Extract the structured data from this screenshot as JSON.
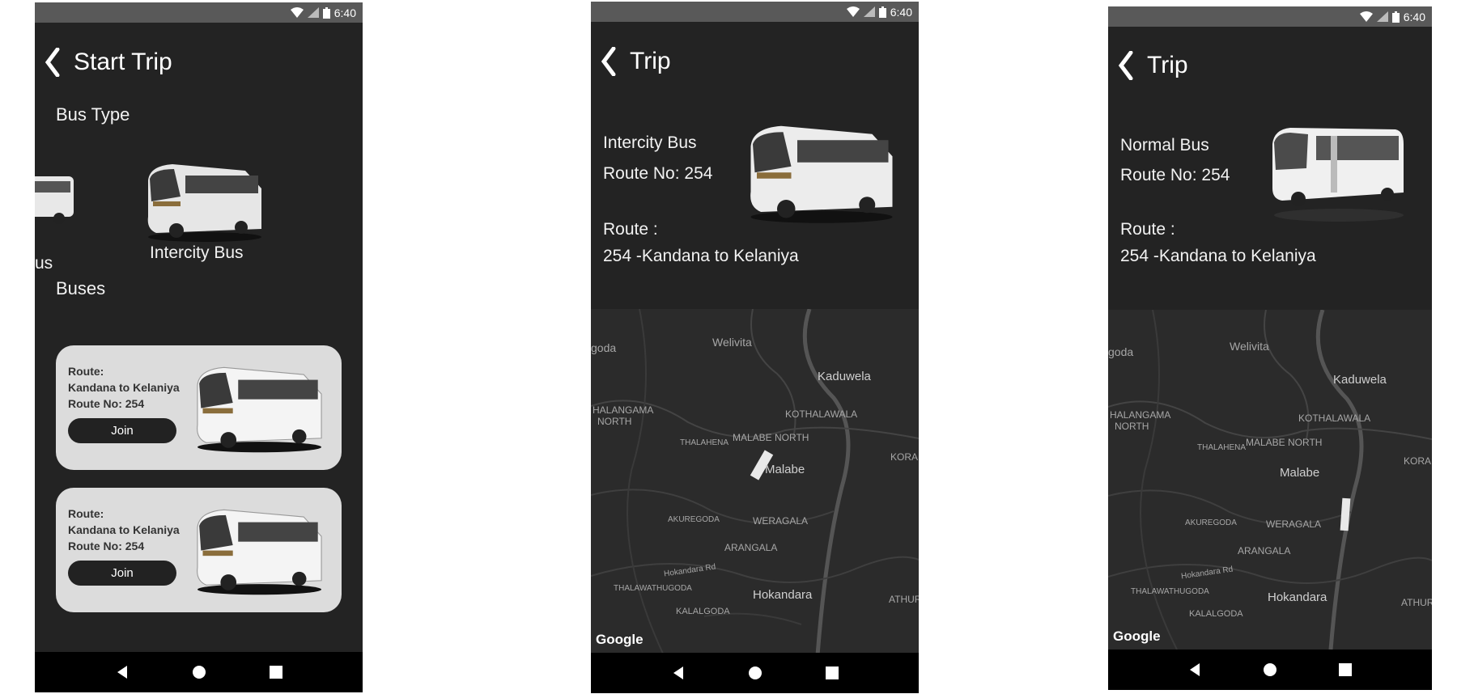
{
  "status_bar": {
    "time": "6:40"
  },
  "screen_start": {
    "title": "Start Trip",
    "bus_type_heading": "Bus Type",
    "bus_types": [
      {
        "label": "us"
      },
      {
        "label": "Intercity Bus"
      }
    ],
    "buses_heading": "Buses",
    "cards": [
      {
        "route_label": "Route:",
        "route": "Kandana to Kelaniya",
        "route_no": "Route No: 254",
        "join_label": "Join"
      },
      {
        "route_label": "Route:",
        "route": "Kandana to Kelaniya",
        "route_no": "Route No: 254",
        "join_label": "Join"
      }
    ]
  },
  "screen_trip_intercity": {
    "title": "Trip",
    "bus_name": "Intercity Bus",
    "route_no": "Route No: 254",
    "route_label": "Route :",
    "route": "254 -Kandana to Kelaniya"
  },
  "screen_trip_normal": {
    "title": "Trip",
    "bus_name": "Normal Bus",
    "route_no": "Route No: 254",
    "route_label": "Route :",
    "route": "254 -Kandana to Kelaniya"
  },
  "map": {
    "labels": {
      "goda": "goda",
      "welivita": "Welivita",
      "kaduwela": "Kaduwela",
      "halangama": "HALANGAMA",
      "north": "NORTH",
      "kothalawala": "KOTHALAWALA",
      "thalahena": "THALAHENA",
      "malabe_north": "MALABE NORTH",
      "malabe": "Malabe",
      "kora": "KORA",
      "akuregoda": "AKUREGODA",
      "weragala": "WERAGALA",
      "arangala": "ARANGALA",
      "hokandara_rd": "Hokandara Rd",
      "thalawathugoda": "THALAWATHUGODA",
      "hokandara": "Hokandara",
      "kalalgoda": "KALALGODA",
      "athur": "ATHUR"
    },
    "attribution": "Google"
  }
}
